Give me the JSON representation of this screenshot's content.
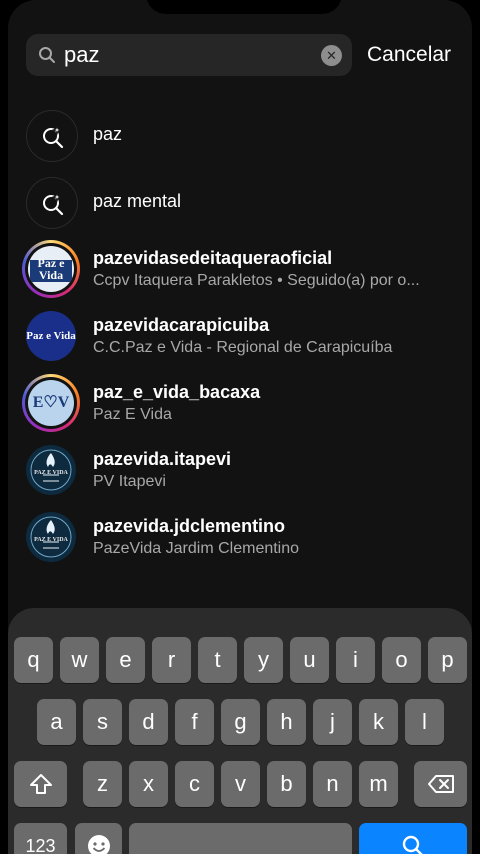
{
  "search": {
    "query": "paz",
    "clear_glyph": "✕",
    "cancel_label": "Cancelar"
  },
  "keyword_results": [
    {
      "label": "paz"
    },
    {
      "label": "paz mental"
    }
  ],
  "account_results": [
    {
      "username": "pazevidasedeitaqueraoficial",
      "subtitle": "Ccpv Itaquera Parakletos • Seguido(a) por o...",
      "has_story_ring": true,
      "avatar_text": "Paz e Vida"
    },
    {
      "username": "pazevidacarapicuiba",
      "subtitle": "C.C.Paz e Vida - Regional de Carapicuíba",
      "has_story_ring": false,
      "avatar_text": "Paz e Vida"
    },
    {
      "username": "paz_e_vida_bacaxa",
      "subtitle": "Paz E Vida",
      "has_story_ring": true,
      "avatar_text": "E♡V"
    },
    {
      "username": "pazevida.itapevi",
      "subtitle": "PV Itapevi",
      "has_story_ring": false,
      "avatar_text": "PAZ E VIDA"
    },
    {
      "username": "pazevida.jdclementino",
      "subtitle": "PazeVida Jardim Clementino",
      "has_story_ring": false,
      "avatar_text": "PAZ E VIDA"
    }
  ],
  "keyboard": {
    "row1": [
      "q",
      "w",
      "e",
      "r",
      "t",
      "y",
      "u",
      "i",
      "o",
      "p"
    ],
    "row2": [
      "a",
      "s",
      "d",
      "f",
      "g",
      "h",
      "j",
      "k",
      "l"
    ],
    "row3": [
      "z",
      "x",
      "c",
      "v",
      "b",
      "n",
      "m"
    ],
    "numbers_label": "123"
  },
  "colors": {
    "background": "#121212",
    "keyboard_bg": "#2b2b2b",
    "key": "#6b6b6b",
    "key_dark": "#464646",
    "search_key": "#0a84ff",
    "subtitle": "#a8a8a8"
  }
}
